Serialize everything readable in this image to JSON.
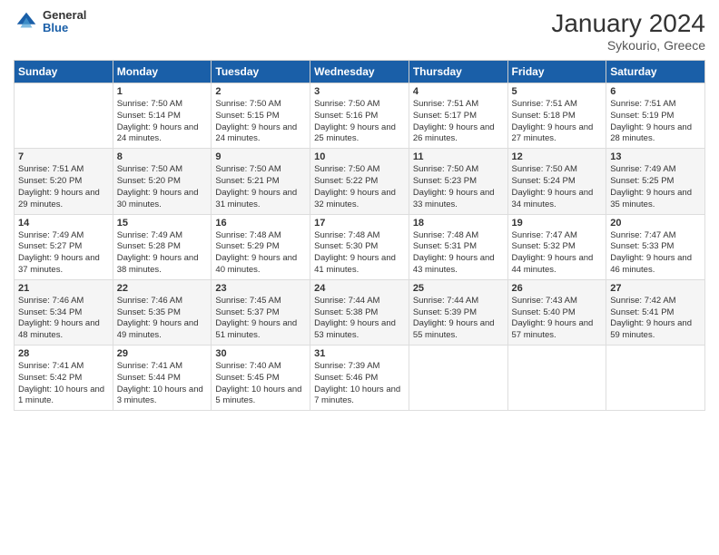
{
  "header": {
    "logo_general": "General",
    "logo_blue": "Blue",
    "title": "January 2024",
    "subtitle": "Sykourio, Greece"
  },
  "weekdays": [
    "Sunday",
    "Monday",
    "Tuesday",
    "Wednesday",
    "Thursday",
    "Friday",
    "Saturday"
  ],
  "weeks": [
    [
      {
        "day": "",
        "sunrise": "",
        "sunset": "",
        "daylight": ""
      },
      {
        "day": "1",
        "sunrise": "Sunrise: 7:50 AM",
        "sunset": "Sunset: 5:14 PM",
        "daylight": "Daylight: 9 hours and 24 minutes."
      },
      {
        "day": "2",
        "sunrise": "Sunrise: 7:50 AM",
        "sunset": "Sunset: 5:15 PM",
        "daylight": "Daylight: 9 hours and 24 minutes."
      },
      {
        "day": "3",
        "sunrise": "Sunrise: 7:50 AM",
        "sunset": "Sunset: 5:16 PM",
        "daylight": "Daylight: 9 hours and 25 minutes."
      },
      {
        "day": "4",
        "sunrise": "Sunrise: 7:51 AM",
        "sunset": "Sunset: 5:17 PM",
        "daylight": "Daylight: 9 hours and 26 minutes."
      },
      {
        "day": "5",
        "sunrise": "Sunrise: 7:51 AM",
        "sunset": "Sunset: 5:18 PM",
        "daylight": "Daylight: 9 hours and 27 minutes."
      },
      {
        "day": "6",
        "sunrise": "Sunrise: 7:51 AM",
        "sunset": "Sunset: 5:19 PM",
        "daylight": "Daylight: 9 hours and 28 minutes."
      }
    ],
    [
      {
        "day": "7",
        "sunrise": "Sunrise: 7:51 AM",
        "sunset": "Sunset: 5:20 PM",
        "daylight": "Daylight: 9 hours and 29 minutes."
      },
      {
        "day": "8",
        "sunrise": "Sunrise: 7:50 AM",
        "sunset": "Sunset: 5:20 PM",
        "daylight": "Daylight: 9 hours and 30 minutes."
      },
      {
        "day": "9",
        "sunrise": "Sunrise: 7:50 AM",
        "sunset": "Sunset: 5:21 PM",
        "daylight": "Daylight: 9 hours and 31 minutes."
      },
      {
        "day": "10",
        "sunrise": "Sunrise: 7:50 AM",
        "sunset": "Sunset: 5:22 PM",
        "daylight": "Daylight: 9 hours and 32 minutes."
      },
      {
        "day": "11",
        "sunrise": "Sunrise: 7:50 AM",
        "sunset": "Sunset: 5:23 PM",
        "daylight": "Daylight: 9 hours and 33 minutes."
      },
      {
        "day": "12",
        "sunrise": "Sunrise: 7:50 AM",
        "sunset": "Sunset: 5:24 PM",
        "daylight": "Daylight: 9 hours and 34 minutes."
      },
      {
        "day": "13",
        "sunrise": "Sunrise: 7:49 AM",
        "sunset": "Sunset: 5:25 PM",
        "daylight": "Daylight: 9 hours and 35 minutes."
      }
    ],
    [
      {
        "day": "14",
        "sunrise": "Sunrise: 7:49 AM",
        "sunset": "Sunset: 5:27 PM",
        "daylight": "Daylight: 9 hours and 37 minutes."
      },
      {
        "day": "15",
        "sunrise": "Sunrise: 7:49 AM",
        "sunset": "Sunset: 5:28 PM",
        "daylight": "Daylight: 9 hours and 38 minutes."
      },
      {
        "day": "16",
        "sunrise": "Sunrise: 7:48 AM",
        "sunset": "Sunset: 5:29 PM",
        "daylight": "Daylight: 9 hours and 40 minutes."
      },
      {
        "day": "17",
        "sunrise": "Sunrise: 7:48 AM",
        "sunset": "Sunset: 5:30 PM",
        "daylight": "Daylight: 9 hours and 41 minutes."
      },
      {
        "day": "18",
        "sunrise": "Sunrise: 7:48 AM",
        "sunset": "Sunset: 5:31 PM",
        "daylight": "Daylight: 9 hours and 43 minutes."
      },
      {
        "day": "19",
        "sunrise": "Sunrise: 7:47 AM",
        "sunset": "Sunset: 5:32 PM",
        "daylight": "Daylight: 9 hours and 44 minutes."
      },
      {
        "day": "20",
        "sunrise": "Sunrise: 7:47 AM",
        "sunset": "Sunset: 5:33 PM",
        "daylight": "Daylight: 9 hours and 46 minutes."
      }
    ],
    [
      {
        "day": "21",
        "sunrise": "Sunrise: 7:46 AM",
        "sunset": "Sunset: 5:34 PM",
        "daylight": "Daylight: 9 hours and 48 minutes."
      },
      {
        "day": "22",
        "sunrise": "Sunrise: 7:46 AM",
        "sunset": "Sunset: 5:35 PM",
        "daylight": "Daylight: 9 hours and 49 minutes."
      },
      {
        "day": "23",
        "sunrise": "Sunrise: 7:45 AM",
        "sunset": "Sunset: 5:37 PM",
        "daylight": "Daylight: 9 hours and 51 minutes."
      },
      {
        "day": "24",
        "sunrise": "Sunrise: 7:44 AM",
        "sunset": "Sunset: 5:38 PM",
        "daylight": "Daylight: 9 hours and 53 minutes."
      },
      {
        "day": "25",
        "sunrise": "Sunrise: 7:44 AM",
        "sunset": "Sunset: 5:39 PM",
        "daylight": "Daylight: 9 hours and 55 minutes."
      },
      {
        "day": "26",
        "sunrise": "Sunrise: 7:43 AM",
        "sunset": "Sunset: 5:40 PM",
        "daylight": "Daylight: 9 hours and 57 minutes."
      },
      {
        "day": "27",
        "sunrise": "Sunrise: 7:42 AM",
        "sunset": "Sunset: 5:41 PM",
        "daylight": "Daylight: 9 hours and 59 minutes."
      }
    ],
    [
      {
        "day": "28",
        "sunrise": "Sunrise: 7:41 AM",
        "sunset": "Sunset: 5:42 PM",
        "daylight": "Daylight: 10 hours and 1 minute."
      },
      {
        "day": "29",
        "sunrise": "Sunrise: 7:41 AM",
        "sunset": "Sunset: 5:44 PM",
        "daylight": "Daylight: 10 hours and 3 minutes."
      },
      {
        "day": "30",
        "sunrise": "Sunrise: 7:40 AM",
        "sunset": "Sunset: 5:45 PM",
        "daylight": "Daylight: 10 hours and 5 minutes."
      },
      {
        "day": "31",
        "sunrise": "Sunrise: 7:39 AM",
        "sunset": "Sunset: 5:46 PM",
        "daylight": "Daylight: 10 hours and 7 minutes."
      },
      {
        "day": "",
        "sunrise": "",
        "sunset": "",
        "daylight": ""
      },
      {
        "day": "",
        "sunrise": "",
        "sunset": "",
        "daylight": ""
      },
      {
        "day": "",
        "sunrise": "",
        "sunset": "",
        "daylight": ""
      }
    ]
  ]
}
